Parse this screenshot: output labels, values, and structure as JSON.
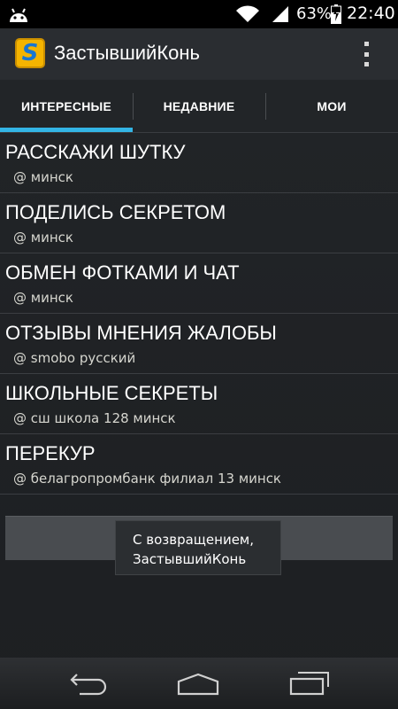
{
  "status_bar": {
    "battery_percent": "63%",
    "time": "22:40",
    "icons": [
      "android-icon",
      "wifi-icon",
      "signal-icon",
      "battery-charging-icon"
    ]
  },
  "action_bar": {
    "logo_letter": "S",
    "title": "ЗастывшийКонь",
    "overflow_icon": "overflow-menu-icon"
  },
  "tabs": [
    {
      "label": "ИНТЕРЕСНЫЕ",
      "active": true
    },
    {
      "label": "НЕДАВНИЕ",
      "active": false
    },
    {
      "label": "МОИ",
      "active": false
    }
  ],
  "topics": [
    {
      "title": "РАССКАЖИ ШУТКУ",
      "location": "@ минск"
    },
    {
      "title": "ПОДЕЛИСЬ СЕКРЕТОМ",
      "location": "@ минск"
    },
    {
      "title": "ОБМЕН ФОТКАМИ И ЧАТ",
      "location": "@ минск"
    },
    {
      "title": "ОТЗЫВЫ МНЕНИЯ ЖАЛОБЫ",
      "location": "@ smobo русский"
    },
    {
      "title": "ШКОЛЬНЫЕ СЕКРЕТЫ",
      "location": "@ сш школа 128 минск"
    },
    {
      "title": "ПЕРЕКУР",
      "location": "@ белагропромбанк филиал 13 минск"
    }
  ],
  "toast": {
    "line1": "С возвращением,",
    "line2": "ЗастывшийКонь"
  },
  "colors": {
    "accent": "#33b5e5",
    "logo_bg": "#f5b400",
    "logo_letter": "#1976d2"
  },
  "nav_bar": {
    "icons": [
      "back-icon",
      "home-icon",
      "recents-icon"
    ]
  }
}
